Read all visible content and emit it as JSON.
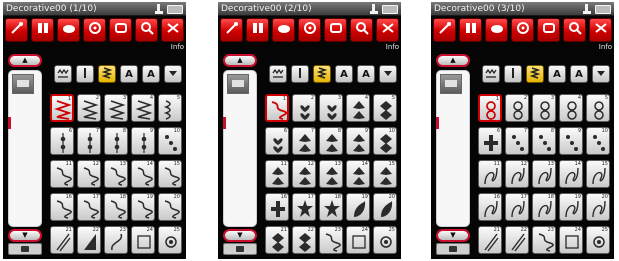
{
  "colors": {
    "accent": "#d00000",
    "highlight": "#e6b400",
    "background": "#050505"
  },
  "screens": [
    {
      "title": "Decorative00 (1/10)",
      "sub_label": "Info",
      "filter_active": 2,
      "selected_tile": 0,
      "tile_nums": [
        [
          "1",
          "2",
          "3",
          "4",
          "5"
        ],
        [
          "6",
          "7",
          "8",
          "9",
          "10"
        ],
        [
          "11",
          "12",
          "13",
          "14",
          "15"
        ],
        [
          "16",
          "17",
          "18",
          "19",
          "20"
        ],
        [
          "21",
          "22",
          "23",
          "24",
          "25"
        ]
      ],
      "patterns": [
        [
          "redzig",
          "zigzag",
          "zigzag",
          "zigzag",
          "scallop"
        ],
        [
          "chain",
          "chain",
          "chain",
          "chain",
          "bead"
        ],
        [
          "wave",
          "wave",
          "wave",
          "wave",
          "wave"
        ],
        [
          "wave",
          "wave",
          "wave",
          "wave",
          "wave"
        ],
        [
          "slant",
          "triangle",
          "curve",
          "square",
          "dot"
        ]
      ]
    },
    {
      "title": "Decorative00 (2/10)",
      "sub_label": "Info",
      "filter_active": 2,
      "selected_tile": 0,
      "tile_nums": [
        [
          "1",
          "2",
          "3",
          "4",
          "5"
        ],
        [
          "6",
          "7",
          "8",
          "9",
          "10"
        ],
        [
          "11",
          "12",
          "13",
          "14",
          "15"
        ],
        [
          "16",
          "17",
          "18",
          "19",
          "20"
        ],
        [
          "21",
          "22",
          "23",
          "24",
          "25"
        ]
      ],
      "patterns": [
        [
          "redwave",
          "heart",
          "heart",
          "spade",
          "diamond"
        ],
        [
          "heart",
          "spade",
          "spade",
          "spade",
          "diamond"
        ],
        [
          "spade",
          "spade",
          "spade",
          "spade",
          "spade"
        ],
        [
          "cross",
          "star",
          "star",
          "leaf",
          "leaf"
        ],
        [
          "diamond",
          "diamond",
          "wave",
          "square",
          "dot"
        ]
      ]
    },
    {
      "title": "Decorative00 (3/10)",
      "sub_label": "Info",
      "filter_active": 2,
      "selected_tile": 0,
      "tile_nums": [
        [
          "1",
          "2",
          "3",
          "4",
          "5"
        ],
        [
          "6",
          "7",
          "8",
          "9",
          "10"
        ],
        [
          "11",
          "12",
          "13",
          "14",
          "15"
        ],
        [
          "16",
          "17",
          "18",
          "19",
          "20"
        ],
        [
          "21",
          "22",
          "23",
          "24",
          "25"
        ]
      ],
      "patterns": [
        [
          "redring",
          "ring",
          "ring",
          "ring",
          "ring"
        ],
        [
          "cross",
          "bead",
          "bead",
          "bead",
          "bead"
        ],
        [
          "loop",
          "loop",
          "loop",
          "loop",
          "loop"
        ],
        [
          "loop",
          "loop",
          "loop",
          "loop",
          "loop"
        ],
        [
          "slant",
          "slant",
          "wave",
          "square",
          "dot"
        ]
      ]
    }
  ],
  "toolbar_icons": [
    "needle-thread-icon",
    "stitch-pattern-icon",
    "presser-foot-icon",
    "bobbin-icon",
    "hoop-icon",
    "magnify-icon",
    "scissors-icon"
  ],
  "filter_icons": [
    "stitch-type-icon",
    "straight-icon",
    "zigzag-icon",
    "letter-a-icon",
    "letter-a-outline-icon",
    "dropdown-icon"
  ],
  "scroll_up_label": "▲",
  "scroll_down_label": "▼",
  "filter_labels": [
    "",
    "",
    "",
    "A",
    "A",
    ""
  ]
}
